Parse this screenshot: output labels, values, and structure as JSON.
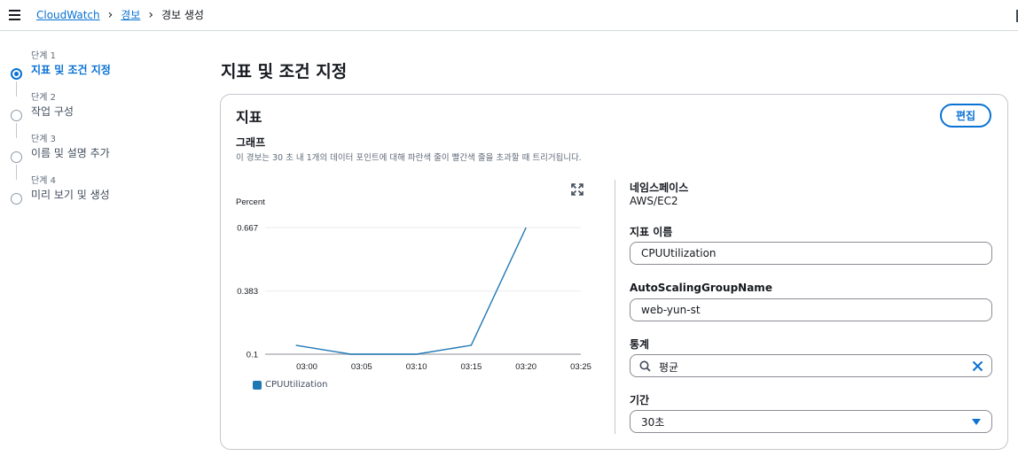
{
  "breadcrumb": {
    "items": [
      "CloudWatch",
      "경보"
    ],
    "current": "경보 생성"
  },
  "steps": [
    {
      "num": "단계 1",
      "label": "지표 및 조건 지정",
      "active": true
    },
    {
      "num": "단계 2",
      "label": "작업 구성",
      "active": false
    },
    {
      "num": "단계 3",
      "label": "이름 및 설명 추가",
      "active": false
    },
    {
      "num": "단계 4",
      "label": "미리 보기 및 생성",
      "active": false
    }
  ],
  "page_title": "지표 및 조건 지정",
  "panel": {
    "title": "지표",
    "edit_label": "편집",
    "graph_title": "그래프",
    "graph_desc": "이 경보는 30 초 내 1개의 데이터 포인트에 대해 파란색 줄이 빨간색 줄을 초과할 때 트리거됩니다."
  },
  "form": {
    "namespace_label": "네임스페이스",
    "namespace_value": "AWS/EC2",
    "metric_label": "지표 이름",
    "metric_value": "CPUUtilization",
    "asg_label": "AutoScalingGroupName",
    "asg_value": "web-yun-st",
    "stat_label": "통계",
    "stat_value": "평균",
    "period_label": "기간",
    "period_value": "30초"
  },
  "icons": {
    "menu": "hamburger-icon",
    "expand": "expand-icon",
    "search": "search-icon",
    "clear": "close-icon",
    "dropdown": "caret-down-icon"
  },
  "colors": {
    "accent": "#0972d3",
    "series": "#1f77b4"
  },
  "chart_data": {
    "type": "line",
    "ylabel": "Percent",
    "yticks": [
      0.1,
      0.383,
      0.667
    ],
    "ytick_labels": [
      "0.1",
      "0.383",
      "0.667"
    ],
    "xticks": [
      "03:00",
      "03:05",
      "03:10",
      "03:15",
      "03:20",
      "03:25"
    ],
    "ylim": [
      0.1,
      0.667
    ],
    "series": [
      {
        "name": "CPUUtilization",
        "x": [
          "02:59",
          "03:04",
          "03:10",
          "03:15",
          "03:20"
        ],
        "values": [
          0.14,
          0.1,
          0.1,
          0.14,
          0.667
        ]
      }
    ]
  }
}
